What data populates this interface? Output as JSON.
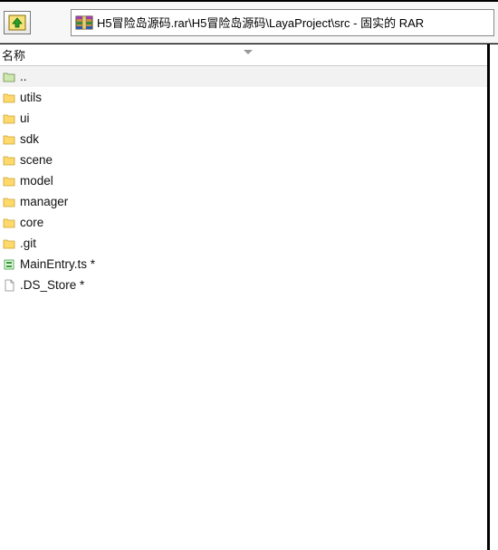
{
  "toolbar": {
    "path": "H5冒险岛源码.rar\\H5冒险岛源码\\LayaProject\\src - 固实的 RAR "
  },
  "column": {
    "name_header": "名称"
  },
  "entries": [
    {
      "kind": "up",
      "label": ".."
    },
    {
      "kind": "folder",
      "label": "utils"
    },
    {
      "kind": "folder",
      "label": "ui"
    },
    {
      "kind": "folder",
      "label": "sdk"
    },
    {
      "kind": "folder",
      "label": "scene"
    },
    {
      "kind": "folder",
      "label": "model"
    },
    {
      "kind": "folder",
      "label": "manager"
    },
    {
      "kind": "folder",
      "label": "core"
    },
    {
      "kind": "folder",
      "label": ".git"
    },
    {
      "kind": "file-ts",
      "label": "MainEntry.ts *"
    },
    {
      "kind": "file",
      "label": ".DS_Store *"
    }
  ]
}
